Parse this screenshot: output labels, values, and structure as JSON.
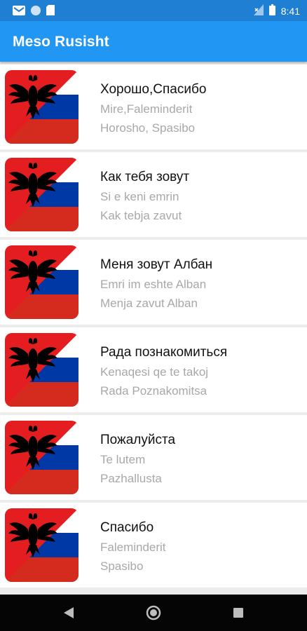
{
  "status_bar": {
    "time": "8:41",
    "icons": [
      "gmail-icon",
      "circle-icon",
      "sd-card-icon",
      "signal-icon",
      "battery-icon"
    ]
  },
  "app_bar": {
    "title": "Meso Rusisht"
  },
  "phrases": [
    {
      "russian": "Хорошо,Спасибо",
      "albanian": "Mire,Faleminderit",
      "transliteration": "Horosho, Spasibo"
    },
    {
      "russian": "Как тебя зовут",
      "albanian": "Si e keni emrin",
      "transliteration": "Kak tebja zavut"
    },
    {
      "russian": "Меня зовут Албан",
      "albanian": "Emri im eshte Alban",
      "transliteration": "Menja zavut Alban"
    },
    {
      "russian": "Рада познакомиться",
      "albanian": "Kenaqesi qe te takoj",
      "transliteration": "Rada Poznakomitsa"
    },
    {
      "russian": "Пожалуйста",
      "albanian": "Te lutem",
      "transliteration": "Pazhallusta"
    },
    {
      "russian": "Спасибо",
      "albanian": "Faleminderit",
      "transliteration": "Spasibo"
    }
  ],
  "nav_bar": {
    "buttons": [
      "back-icon",
      "home-icon",
      "recents-icon"
    ]
  },
  "colors": {
    "status": "#1e7fd3",
    "app_bar": "#2196f3",
    "flag_red": "#e41e20",
    "ru_blue": "#0039a6",
    "ru_red": "#d52b1e"
  }
}
